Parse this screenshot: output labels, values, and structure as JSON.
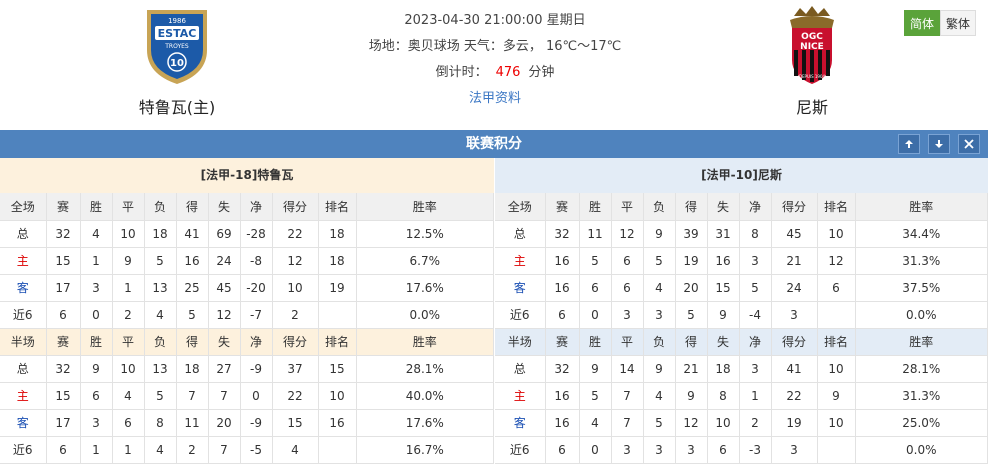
{
  "header": {
    "home_team": "特鲁瓦(主)",
    "away_team": "尼斯",
    "datetime": "2023-04-30 21:00:00 星期日",
    "venue_label": "场地：奥贝球场",
    "weather": "天气：多云， 16℃～17℃",
    "countdown_label": "倒计时：",
    "countdown_value": "476",
    "countdown_unit": "分钟",
    "league_link": "法甲资料",
    "home_logo_text": "ESTAC",
    "home_logo_sub": "TROYES",
    "home_logo_year": "1986",
    "home_logo_num": "10",
    "away_logo_text": "OGC",
    "away_logo_sub": "NICE",
    "away_logo_year": "DEPUIS 1904"
  },
  "lang": {
    "simplified": "简体",
    "traditional": "繁体"
  },
  "section_title": "联赛积分",
  "columns": [
    "赛",
    "胜",
    "平",
    "负",
    "得",
    "失",
    "净",
    "得分",
    "排名",
    "胜率"
  ],
  "left": {
    "title": "[法甲-18]特鲁瓦",
    "full_label": "全场",
    "full": [
      [
        "总",
        "32",
        "4",
        "10",
        "18",
        "41",
        "69",
        "-28",
        "22",
        "18",
        "12.5%"
      ],
      [
        "主",
        "15",
        "1",
        "9",
        "5",
        "16",
        "24",
        "-8",
        "12",
        "18",
        "6.7%"
      ],
      [
        "客",
        "17",
        "3",
        "1",
        "13",
        "25",
        "45",
        "-20",
        "10",
        "19",
        "17.6%"
      ],
      [
        "近6",
        "6",
        "0",
        "2",
        "4",
        "5",
        "12",
        "-7",
        "2",
        "",
        "0.0%"
      ]
    ],
    "half_label": "半场",
    "half": [
      [
        "总",
        "32",
        "9",
        "10",
        "13",
        "18",
        "27",
        "-9",
        "37",
        "15",
        "28.1%"
      ],
      [
        "主",
        "15",
        "6",
        "4",
        "5",
        "7",
        "7",
        "0",
        "22",
        "10",
        "40.0%"
      ],
      [
        "客",
        "17",
        "3",
        "6",
        "8",
        "11",
        "20",
        "-9",
        "15",
        "16",
        "17.6%"
      ],
      [
        "近6",
        "6",
        "1",
        "1",
        "4",
        "2",
        "7",
        "-5",
        "4",
        "",
        "16.7%"
      ]
    ]
  },
  "right": {
    "title": "[法甲-10]尼斯",
    "full_label": "全场",
    "full": [
      [
        "总",
        "32",
        "11",
        "12",
        "9",
        "39",
        "31",
        "8",
        "45",
        "10",
        "34.4%"
      ],
      [
        "主",
        "16",
        "5",
        "6",
        "5",
        "19",
        "16",
        "3",
        "21",
        "12",
        "31.3%"
      ],
      [
        "客",
        "16",
        "6",
        "6",
        "4",
        "20",
        "15",
        "5",
        "24",
        "6",
        "37.5%"
      ],
      [
        "近6",
        "6",
        "0",
        "3",
        "3",
        "5",
        "9",
        "-4",
        "3",
        "",
        "0.0%"
      ]
    ],
    "half_label": "半场",
    "half": [
      [
        "总",
        "32",
        "9",
        "14",
        "9",
        "21",
        "18",
        "3",
        "41",
        "10",
        "28.1%"
      ],
      [
        "主",
        "16",
        "5",
        "7",
        "4",
        "9",
        "8",
        "1",
        "22",
        "9",
        "31.3%"
      ],
      [
        "客",
        "16",
        "4",
        "7",
        "5",
        "12",
        "10",
        "2",
        "19",
        "10",
        "25.0%"
      ],
      [
        "近6",
        "6",
        "0",
        "3",
        "3",
        "3",
        "6",
        "-3",
        "3",
        "",
        "0.0%"
      ]
    ]
  },
  "colors": {
    "section_bar": "#4f83be",
    "home_text": "#d00000",
    "away_text": "#1a4fb3",
    "lang_active": "#5aa33a"
  }
}
